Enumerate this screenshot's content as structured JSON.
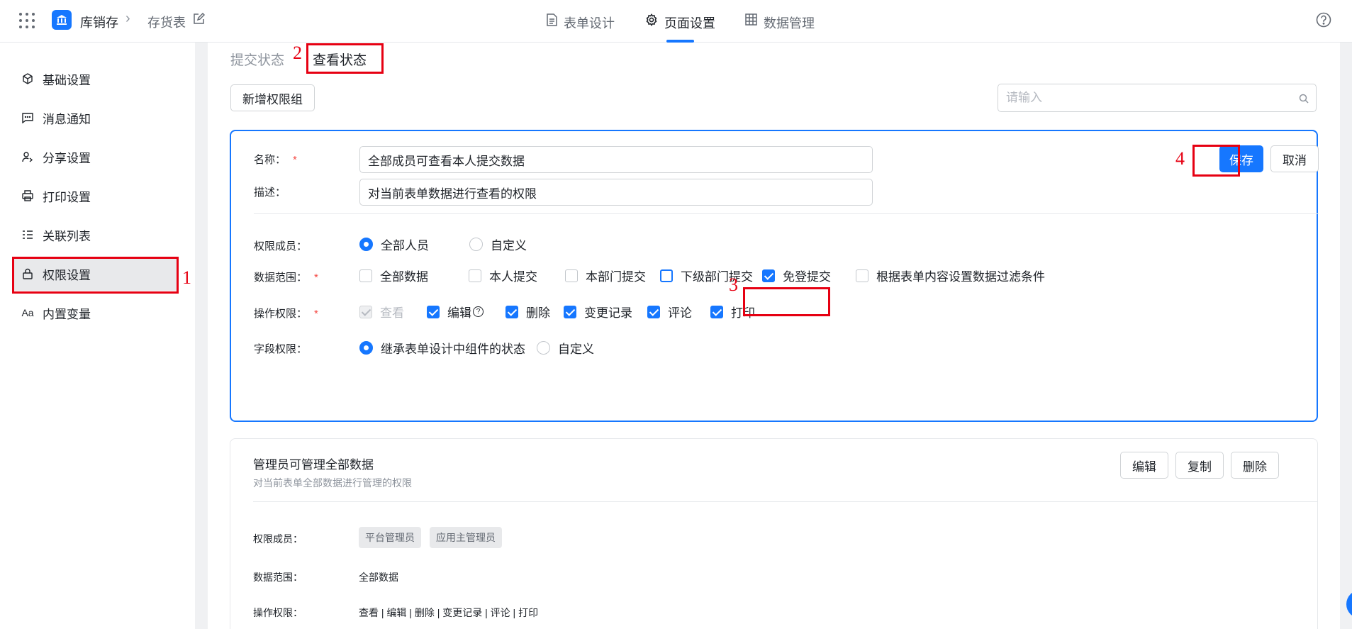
{
  "header": {
    "app_name": "库销存",
    "form_name": "存货表",
    "tabs": [
      {
        "label": "表单设计",
        "icon": "document-icon"
      },
      {
        "label": "页面设置",
        "icon": "gear-icon"
      },
      {
        "label": "数据管理",
        "icon": "table-icon"
      }
    ],
    "active_tab": "页面设置"
  },
  "sidebar": {
    "items": [
      {
        "label": "基础设置",
        "icon": "cube-icon"
      },
      {
        "label": "消息通知",
        "icon": "message-icon"
      },
      {
        "label": "分享设置",
        "icon": "share-user-icon"
      },
      {
        "label": "打印设置",
        "icon": "printer-icon"
      },
      {
        "label": "关联列表",
        "icon": "list-icon"
      },
      {
        "label": "权限设置",
        "icon": "lock-icon"
      },
      {
        "label": "内置变量",
        "icon": "text-variable-icon",
        "glyph": "Aa"
      }
    ],
    "active_item": "权限设置"
  },
  "main": {
    "sub_tabs": [
      "提交状态",
      "查看状态"
    ],
    "active_sub_tab": "查看状态",
    "add_group_label": "新增权限组",
    "search_placeholder": "请输入"
  },
  "edit_card": {
    "name_label": "名称：",
    "name_value": "全部成员可查看本人提交数据",
    "desc_label": "描述：",
    "desc_value": "对当前表单数据进行查看的权限",
    "required_mark": "*",
    "save_label": "保存",
    "cancel_label": "取消",
    "members_label": "权限成员：",
    "members_options": [
      {
        "label": "全部人员",
        "selected": true
      },
      {
        "label": "自定义",
        "selected": false
      }
    ],
    "scope_label": "数据范围：",
    "scope_options": [
      {
        "label": "全部数据",
        "checked": false
      },
      {
        "label": "本人提交",
        "checked": false
      },
      {
        "label": "本部门提交",
        "checked": false
      },
      {
        "label": "下级部门提交",
        "checked": false
      },
      {
        "label": "免登提交",
        "checked": true
      },
      {
        "label": "根据表单内容设置数据过滤条件",
        "checked": false
      }
    ],
    "ops_label": "操作权限：",
    "ops_options": [
      {
        "label": "查看",
        "checked": true,
        "disabled": true
      },
      {
        "label": "编辑",
        "checked": true,
        "help": "?"
      },
      {
        "label": "删除",
        "checked": true
      },
      {
        "label": "变更记录",
        "checked": true
      },
      {
        "label": "评论",
        "checked": true
      },
      {
        "label": "打印",
        "checked": true
      }
    ],
    "field_label": "字段权限：",
    "field_options": [
      {
        "label": "继承表单设计中组件的状态",
        "selected": true
      },
      {
        "label": "自定义",
        "selected": false
      }
    ]
  },
  "admin_card": {
    "title": "管理员可管理全部数据",
    "description": "对当前表单全部数据进行管理的权限",
    "edit_label": "编辑",
    "copy_label": "复制",
    "delete_label": "删除",
    "members_label": "权限成员：",
    "member_tags": [
      "平台管理员",
      "应用主管理员"
    ],
    "scope_label": "数据范围：",
    "scope_value": "全部数据",
    "ops_label": "操作权限：",
    "ops_value": "查看 | 编辑 | 删除 | 变更记录 | 评论 | 打印"
  },
  "annotations": [
    "1",
    "2",
    "3",
    "4"
  ],
  "colors": {
    "accent": "#1677ff",
    "annotation": "#e60012",
    "required": "#f54a45"
  }
}
